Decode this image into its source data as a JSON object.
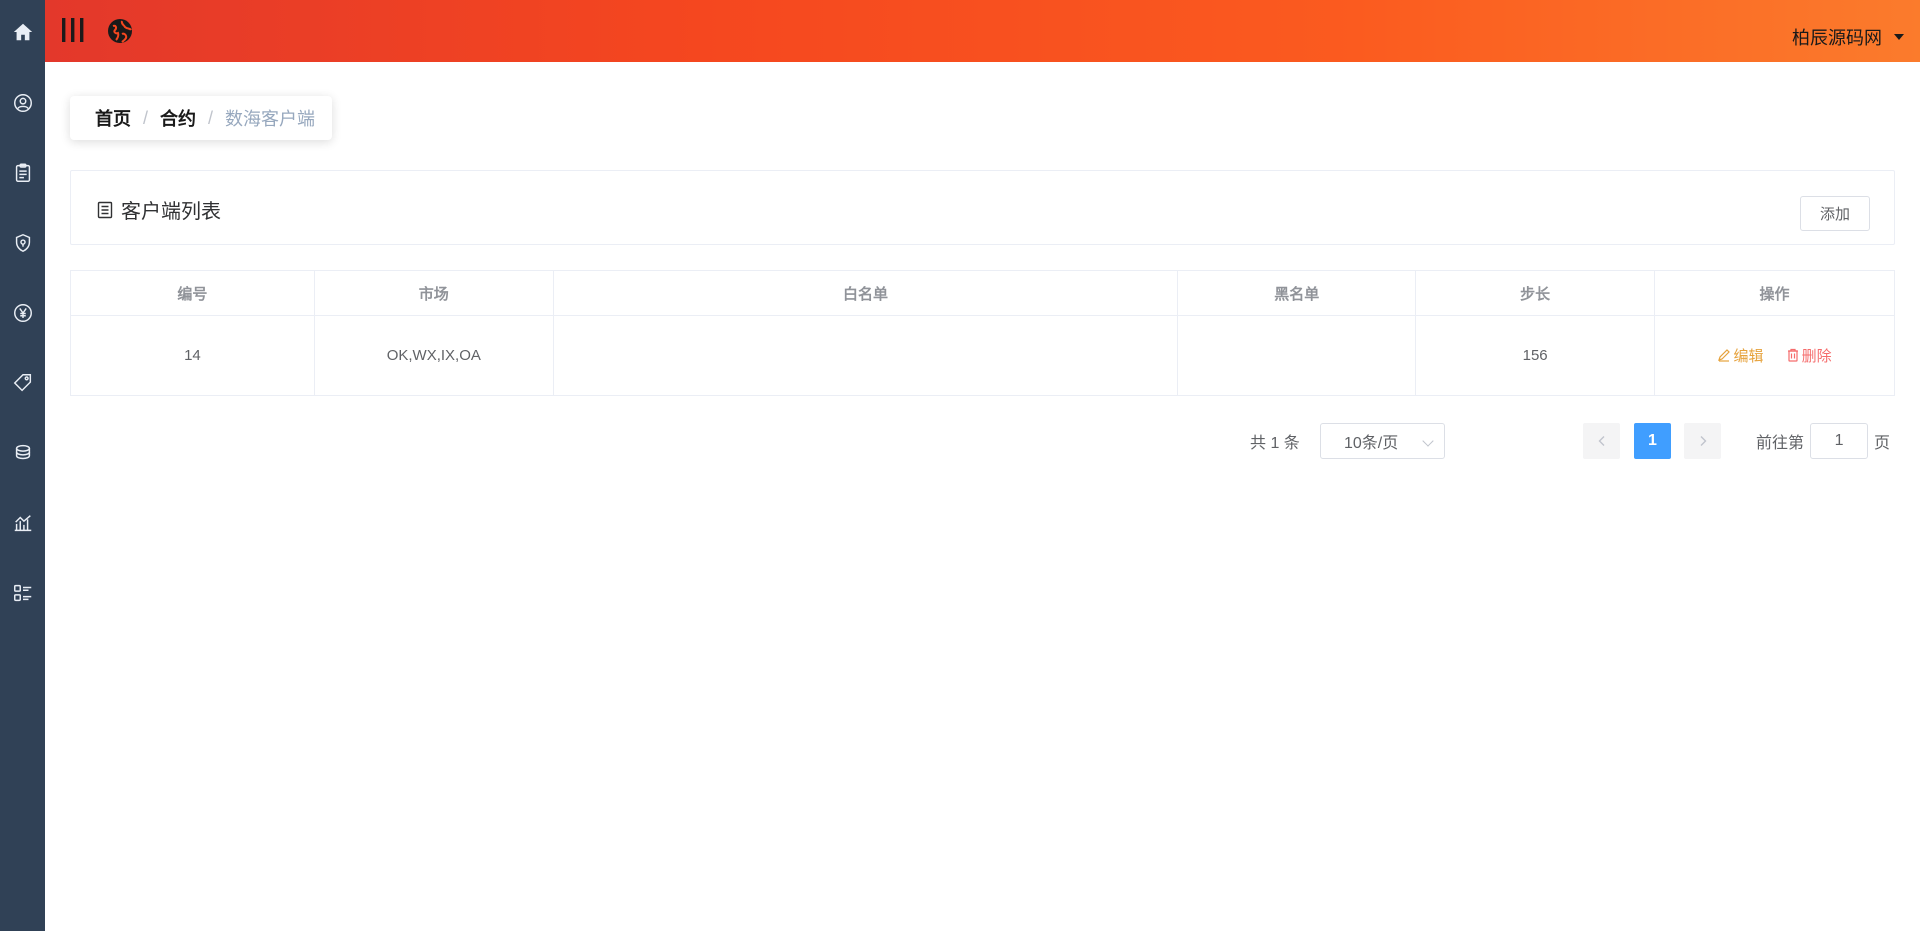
{
  "sidebar": {
    "items": [
      {
        "icon": "home-icon"
      },
      {
        "icon": "user-circle-icon"
      },
      {
        "icon": "clipboard-icon"
      },
      {
        "icon": "shield-icon"
      },
      {
        "icon": "yen-icon"
      },
      {
        "icon": "tag-icon"
      },
      {
        "icon": "coins-icon"
      },
      {
        "icon": "chart-icon"
      },
      {
        "icon": "list-icon"
      }
    ],
    "background": "#304156"
  },
  "header": {
    "user_name": "柏辰源码网",
    "gradient": [
      "#e3382b",
      "#fb7b2c"
    ]
  },
  "breadcrumb": {
    "items": [
      "首页",
      "合约",
      "数海客户端"
    ],
    "separator": "/"
  },
  "card": {
    "title": "客户端列表",
    "add_label": "添加"
  },
  "table": {
    "columns": [
      "编号",
      "市场",
      "白名单",
      "黑名单",
      "步长",
      "操作"
    ],
    "rows": [
      {
        "id": "14",
        "market": "OK,WX,IX,OA",
        "whitelist": "",
        "blacklist": "",
        "step": "156"
      }
    ],
    "edit_label": "编辑",
    "delete_label": "删除"
  },
  "pagination": {
    "total_text": "共 1 条",
    "page_size": "10条/页",
    "current_page": "1",
    "goto_prefix": "前往第",
    "goto_value": "1",
    "goto_suffix": "页"
  },
  "colors": {
    "primary": "#409eff",
    "warning": "#e6a23c",
    "danger": "#f56c6c"
  }
}
